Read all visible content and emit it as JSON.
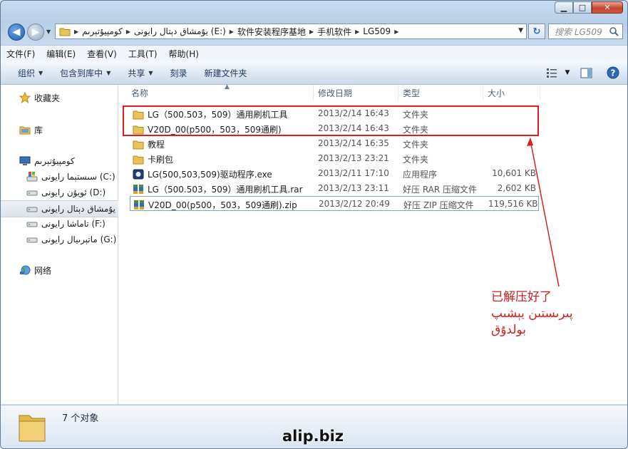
{
  "window": {
    "min_label": "▁",
    "max_label": "□",
    "close_label": "✕"
  },
  "address": {
    "crumbs": [
      "كومپيۇتېرىم",
      "يۇمشاق دېتال رايونى (E:)",
      "软件安装程序基地",
      "手机软件",
      "LG509"
    ]
  },
  "search": {
    "placeholder": "搜索 LG509"
  },
  "menu": [
    "文件(F)",
    "编辑(E)",
    "查看(V)",
    "工具(T)",
    "帮助(H)"
  ],
  "toolbar": {
    "organize": "组织",
    "include": "包含到库中",
    "share": "共享",
    "burn": "刻录",
    "new_folder": "新建文件夹"
  },
  "nav_pane": {
    "favorites": "收藏夹",
    "libraries": "库",
    "computer": "كومپيۇتېرىم",
    "drives": [
      {
        "label": "سىستېما رايونى (C:)",
        "selected": false
      },
      {
        "label": "ئويۇن رايونى (D:)",
        "selected": false
      },
      {
        "label": "يۇمشاق دېتال رايونى (E:)",
        "selected": true
      },
      {
        "label": "تاماشا رايونى (F:)",
        "selected": false
      },
      {
        "label": "ماتېرىيال رايونى (G:)",
        "selected": false
      }
    ],
    "network": "网络"
  },
  "columns": {
    "name": "名称",
    "date": "修改日期",
    "type": "类型",
    "size": "大小"
  },
  "files": [
    {
      "name": "LG（500.503，509）通用刷机工具",
      "date": "2013/2/14 16:43",
      "type": "文件夹",
      "size": "",
      "icon": "folder-icon"
    },
    {
      "name": "V20D_00(p500，503，509通刷)",
      "date": "2013/2/14 16:43",
      "type": "文件夹",
      "size": "",
      "icon": "folder-icon"
    },
    {
      "name": "教程",
      "date": "2013/2/14 16:35",
      "type": "文件夹",
      "size": "",
      "icon": "folder-icon"
    },
    {
      "name": "卡刷包",
      "date": "2013/2/13 23:21",
      "type": "文件夹",
      "size": "",
      "icon": "folder-icon"
    },
    {
      "name": "LG(500,503,509)驱动程序.exe",
      "date": "2013/2/11 17:10",
      "type": "应用程序",
      "size": "10,601 KB",
      "icon": "exe-icon"
    },
    {
      "name": "LG（500.503，509）通用刷机工具.rar",
      "date": "2013/2/13 23:11",
      "type": "好压 RAR 压缩文件",
      "size": "2,602 KB",
      "icon": "archive-icon"
    },
    {
      "name": "V20D_00(p500，503，509通刷).zip",
      "date": "2013/2/12 20:49",
      "type": "好压 ZIP 压缩文件",
      "size": "119,516 KB",
      "icon": "archive-icon"
    }
  ],
  "status": {
    "count": "7 个对象"
  },
  "annotation": {
    "lines": [
      "已解压好了",
      "پىرىستىن يېشىپ",
      "بولدۇق"
    ],
    "color": "#cf1f1f"
  },
  "watermark": "alip.biz"
}
